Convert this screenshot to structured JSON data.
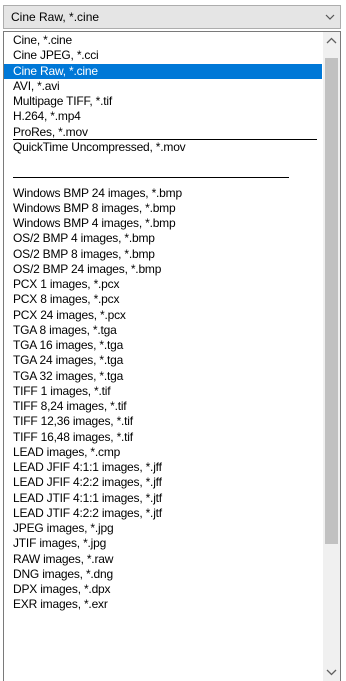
{
  "combo": {
    "value": "Cine Raw, *.cine",
    "icon": "chevron-down-icon"
  },
  "list": {
    "selected_index": 2,
    "items": [
      "Cine, *.cine",
      "Cine JPEG, *.cci",
      "Cine Raw, *.cine",
      "AVI, *.avi",
      "Multipage TIFF, *.tif",
      "H.264, *.mp4",
      "ProRes, *.mov",
      "QuickTime Uncompressed, *.mov",
      "",
      "",
      "Windows BMP 24 images, *.bmp",
      "Windows BMP 8 images, *.bmp",
      "Windows BMP 4 images, *.bmp",
      "OS/2 BMP 4 images, *.bmp",
      "OS/2 BMP 8 images, *.bmp",
      "OS/2 BMP 24 images, *.bmp",
      "PCX 1 images, *.pcx",
      "PCX 8 images, *.pcx",
      "PCX 24 images, *.pcx",
      "TGA 8 images, *.tga",
      "TGA 16 images, *.tga",
      "TGA 24 images, *.tga",
      "TGA 32 images, *.tga",
      "TIFF 1 images, *.tif",
      "TIFF 8,24 images, *.tif",
      "TIFF 12,36 images, *.tif",
      "TIFF 16,48 images, *.tif",
      "LEAD images, *.cmp",
      "LEAD JFIF 4:1:1 images, *.jff",
      "LEAD JFIF 4:2:2 images, *.jff",
      "LEAD JTIF 4:1:1 images, *.jtf",
      "LEAD JTIF 4:2:2 images, *.jtf",
      "JPEG images, *.jpg",
      "JTIF images, *.jpg",
      "RAW images, *.raw",
      "DNG images, *.dng",
      "DPX images, *.dpx",
      "EXR images, *.exr"
    ]
  },
  "scrollbar": {
    "up_icon": "scroll-up-icon",
    "down_icon": "scroll-down-icon",
    "position": 0.0
  }
}
